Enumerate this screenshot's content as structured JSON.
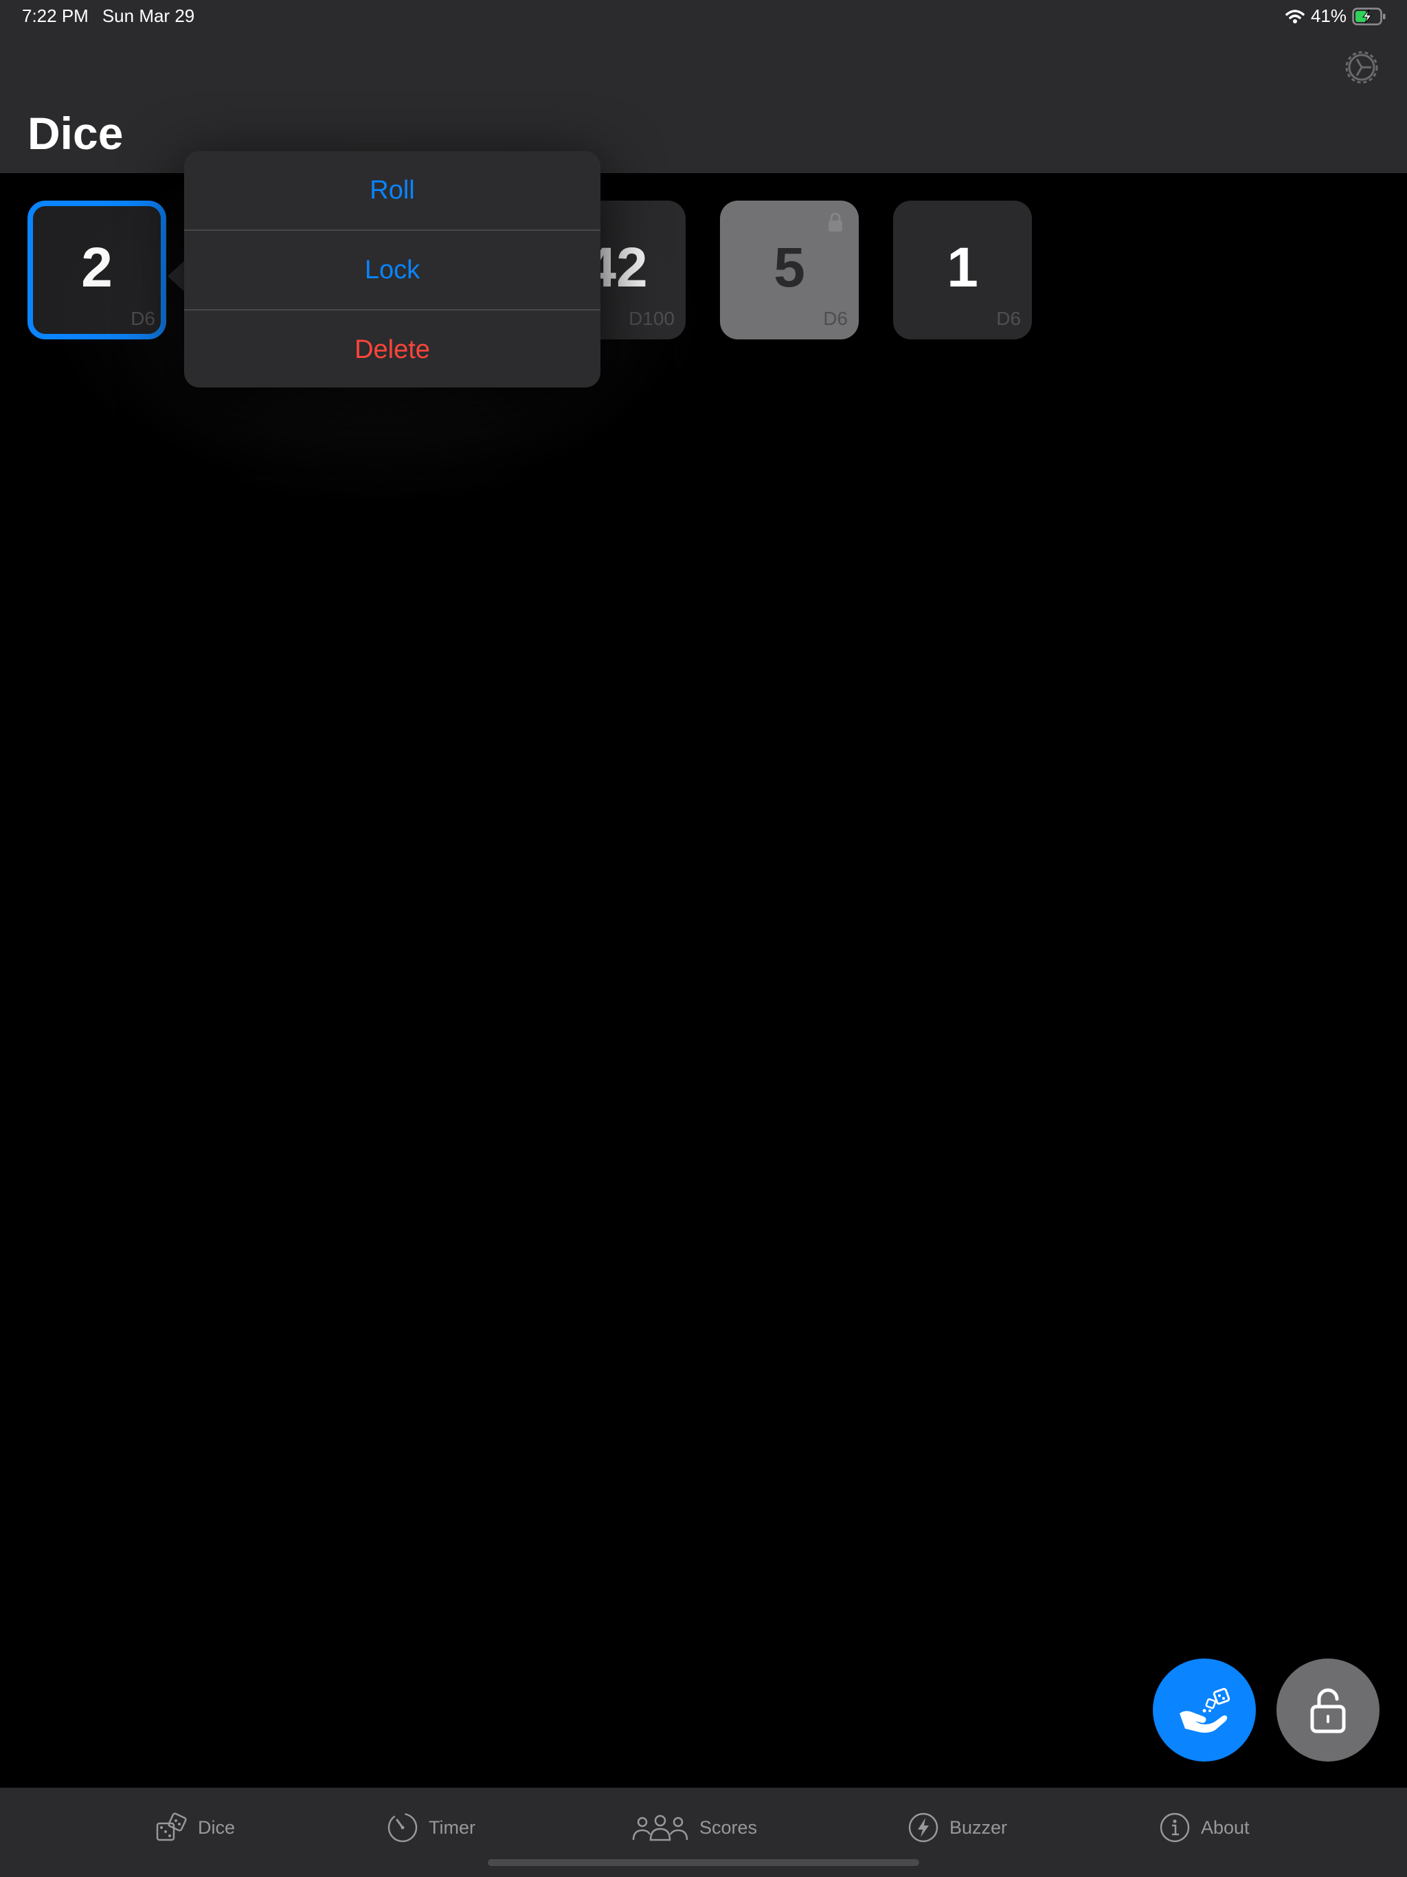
{
  "status": {
    "time": "7:22 PM",
    "date": "Sun Mar 29",
    "battery": "41%"
  },
  "header": {
    "title": "Dice",
    "settings_icon": "gear-icon"
  },
  "dice": [
    {
      "value": "2",
      "type": "D6",
      "state": "selected"
    },
    {
      "value": "42",
      "type": "D100",
      "state": "normal"
    },
    {
      "value": "5",
      "type": "D6",
      "state": "locked"
    },
    {
      "value": "1",
      "type": "D6",
      "state": "normal"
    }
  ],
  "menu": {
    "roll": "Roll",
    "lock": "Lock",
    "delete": "Delete"
  },
  "actions": {
    "roll_icon": "hand-dice-icon",
    "lock_icon": "lock-icon"
  },
  "tabs": [
    {
      "label": "Dice",
      "icon": "dice-icon"
    },
    {
      "label": "Timer",
      "icon": "timer-icon"
    },
    {
      "label": "Scores",
      "icon": "people-icon"
    },
    {
      "label": "Buzzer",
      "icon": "bolt-icon"
    },
    {
      "label": "About",
      "icon": "info-icon"
    }
  ],
  "colors": {
    "accent": "#0a84ff",
    "destructive": "#ff453a",
    "background": "#000000",
    "bar": "#2b2b2d",
    "battery": "#30d158"
  }
}
